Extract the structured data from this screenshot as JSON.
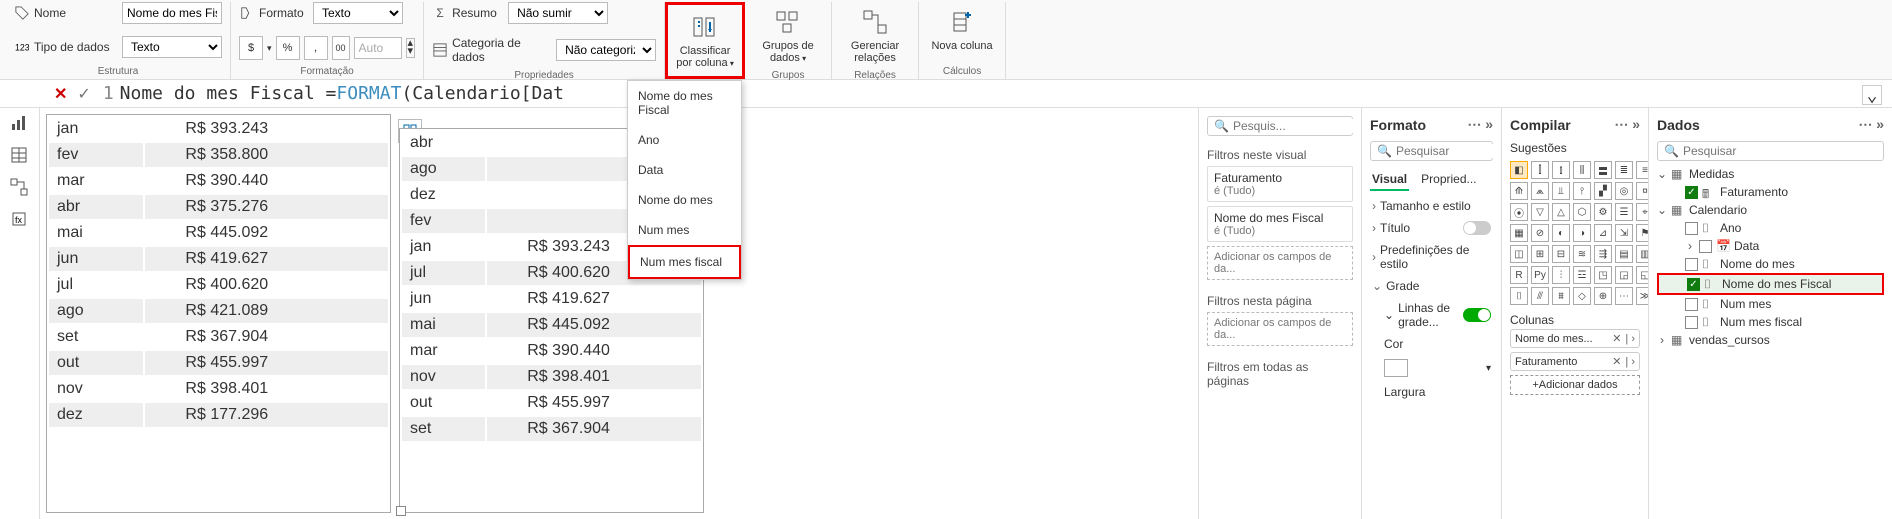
{
  "ribbon": {
    "estrutura": {
      "nome_label": "Nome",
      "nome_value": "Nome do mes Fiscal",
      "tipo_label": "Tipo de dados",
      "tipo_value": "Texto",
      "group_label": "Estrutura"
    },
    "formatacao": {
      "formato_label": "Formato",
      "formato_value": "Texto",
      "currency": "$",
      "pct": "%",
      "sep": ",",
      "decimals_label": "00",
      "auto_value": "Auto",
      "group_label": "Formatação"
    },
    "propriedades": {
      "resumo_label": "Resumo",
      "resumo_value": "Não sumir",
      "cat_label": "Categoria de dados",
      "cat_value": "Não categorizado",
      "group_label": "Propriedades"
    },
    "classificar": {
      "label": "Classificar por coluna"
    },
    "grupos": {
      "label": "Grupos de dados",
      "group_label": "Grupos"
    },
    "relacoes": {
      "label": "Gerenciar relações",
      "group_label": "Relações"
    },
    "nova_coluna": {
      "label": "Nova coluna",
      "group_label": "Cálculos"
    }
  },
  "dropdown_items": [
    "Nome do mes Fiscal",
    "Ano",
    "Data",
    "Nome do mes",
    "Num mes",
    "Num mes fiscal"
  ],
  "formula": {
    "index": "1",
    "lhs": "Nome do mes Fiscal = ",
    "func": "FORMAT",
    "paren": "(",
    "ref": "Calendario[Dat"
  },
  "table1": [
    [
      "jan",
      "R$ 393.243"
    ],
    [
      "fev",
      "R$ 358.800"
    ],
    [
      "mar",
      "R$ 390.440"
    ],
    [
      "abr",
      "R$ 375.276"
    ],
    [
      "mai",
      "R$ 445.092"
    ],
    [
      "jun",
      "R$ 419.627"
    ],
    [
      "jul",
      "R$ 400.620"
    ],
    [
      "ago",
      "R$ 421.089"
    ],
    [
      "set",
      "R$ 367.904"
    ],
    [
      "out",
      "R$ 455.997"
    ],
    [
      "nov",
      "R$ 398.401"
    ],
    [
      "dez",
      "R$ 177.296"
    ]
  ],
  "table2": [
    [
      "abr",
      ""
    ],
    [
      "ago",
      ""
    ],
    [
      "dez",
      ""
    ],
    [
      "fev",
      ""
    ],
    [
      "jan",
      "R$ 393.243"
    ],
    [
      "jul",
      "R$ 400.620"
    ],
    [
      "jun",
      "R$ 419.627"
    ],
    [
      "mai",
      "R$ 445.092"
    ],
    [
      "mar",
      "R$ 390.440"
    ],
    [
      "nov",
      "R$ 398.401"
    ],
    [
      "out",
      "R$ 455.997"
    ],
    [
      "set",
      "R$ 367.904"
    ]
  ],
  "filters": {
    "search_ph": "Pesquis...",
    "neste_visual": "Filtros neste visual",
    "f1_name": "Faturamento",
    "f1_sub": "é (Tudo)",
    "f2_name": "Nome do mes Fiscal",
    "f2_sub": "é (Tudo)",
    "add_fields": "Adicionar os campos de da...",
    "nesta_pagina": "Filtros nesta página",
    "todas": "Filtros em todas as páginas"
  },
  "format": {
    "title": "Formato",
    "search_ph": "Pesquisar",
    "tab_visual": "Visual",
    "tab_prop": "Propried...",
    "tamanho": "Tamanho e estilo",
    "titulo": "Título",
    "predef": "Predefinições de estilo",
    "grade": "Grade",
    "linhas_grade": "Linhas de grade...",
    "cor": "Cor",
    "largura": "Largura"
  },
  "viz": {
    "title": "Compilar",
    "sugestoes": "Sugestões",
    "colunas": "Colunas",
    "pill1": "Nome do mes...",
    "pill2": "Faturamento",
    "add": "+Adicionar dados"
  },
  "data": {
    "title": "Dados",
    "search_ph": "Pesquisar",
    "medidas": "Medidas",
    "faturamento": "Faturamento",
    "calendario": "Calendario",
    "ano": "Ano",
    "data": "Data",
    "nome_mes": "Nome do mes",
    "nome_mes_fiscal": "Nome do mes Fiscal",
    "num_mes": "Num mes",
    "num_mes_fiscal": "Num mes fiscal",
    "vendas": "vendas_cursos"
  }
}
